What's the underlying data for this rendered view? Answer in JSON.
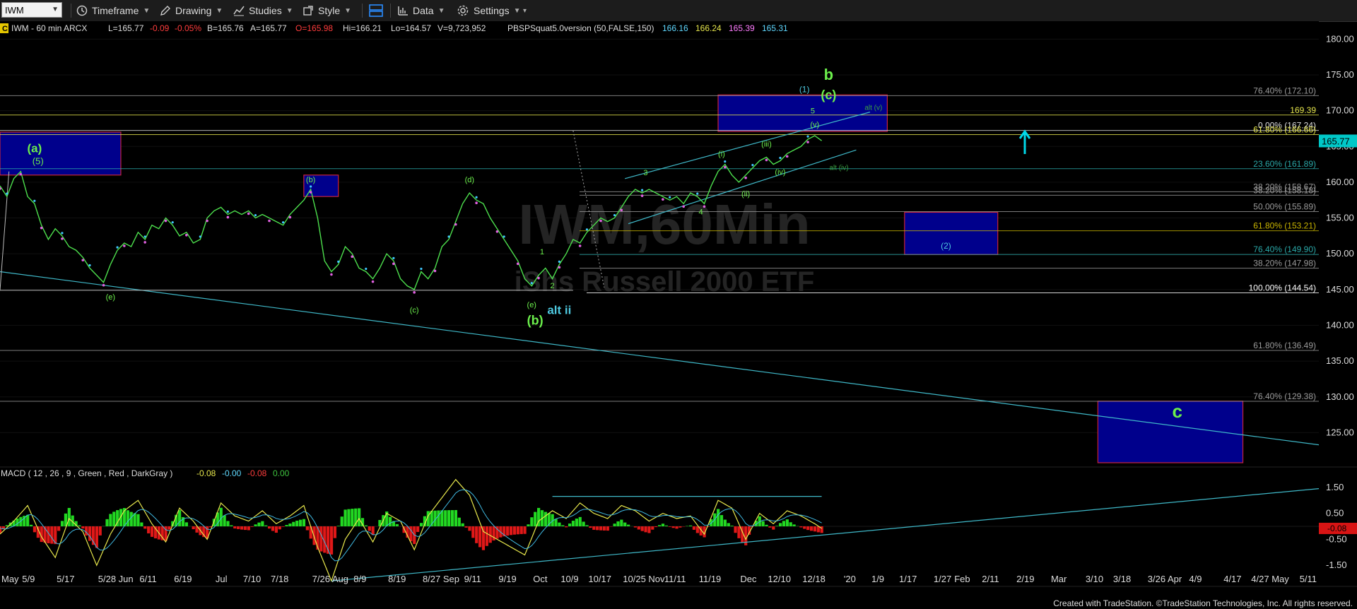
{
  "toolbar": {
    "symbol": "IWM",
    "timeframe": "Timeframe",
    "drawing": "Drawing",
    "studies": "Studies",
    "style": "Style",
    "data": "Data",
    "settings": "Settings"
  },
  "header": {
    "c_badge": "C",
    "title": "IWM - 60 min  ARCX",
    "last": "L=165.77",
    "change": "-0.09",
    "pct": "-0.05%",
    "bid": "B=165.76",
    "ask": "A=165.77",
    "open": "O=165.98",
    "high": "Hi=166.21",
    "low": "Lo=164.57",
    "volume": "V=9,723,952",
    "study": "PBSPSquat5.0version (50,FALSE,150)",
    "study_v1": "166.16",
    "study_v2": "166.24",
    "study_v3": "165.39",
    "study_v4": "165.31"
  },
  "watermark": {
    "symbol": "IWM,60Min",
    "name": "iShs Russell 2000 ETF"
  },
  "copyright": "Created with TradeStation. ©TradeStation Technologies, Inc. All rights reserved.",
  "chart_data": [
    {
      "type": "line",
      "title": "IWM - 60 min",
      "ylim": [
        120.5,
        182.5
      ],
      "y_ticks": [
        180,
        175,
        170,
        165,
        160,
        155,
        150,
        145,
        140,
        135,
        130,
        125
      ],
      "y_tick_labels": [
        "180.00",
        "175.00",
        "170.00",
        "165.00",
        "160.00",
        "155.00",
        "150.00",
        "145.00",
        "140.00",
        "135.00",
        "130.00",
        "125.00"
      ],
      "last_price": {
        "value": 165.77,
        "label": "165.77",
        "color": "#00c8c8"
      },
      "x_tick_labels": [
        {
          "label": "May",
          "x": 0
        },
        {
          "label": "5/9",
          "x": 3
        },
        {
          "label": "5/17",
          "x": 8
        },
        {
          "label": "5/28 Jun",
          "x": 14
        },
        {
          "label": "6/11",
          "x": 20
        },
        {
          "label": "6/19",
          "x": 25
        },
        {
          "label": "Jul",
          "x": 31
        },
        {
          "label": "7/10",
          "x": 35
        },
        {
          "label": "7/18",
          "x": 39
        },
        {
          "label": "7/26 Aug",
          "x": 45
        },
        {
          "label": "8/9",
          "x": 51
        },
        {
          "label": "8/19",
          "x": 56
        },
        {
          "label": "8/27 Sep",
          "x": 61
        },
        {
          "label": "9/11",
          "x": 67
        },
        {
          "label": "9/19",
          "x": 72
        },
        {
          "label": "Oct",
          "x": 77
        },
        {
          "label": "10/9",
          "x": 81
        },
        {
          "label": "10/17",
          "x": 85
        },
        {
          "label": "10/25 Nov",
          "x": 90
        },
        {
          "label": "11/11",
          "x": 96
        },
        {
          "label": "11/19",
          "x": 101
        },
        {
          "label": "Dec",
          "x": 107
        },
        {
          "label": "12/10",
          "x": 111
        },
        {
          "label": "12/18",
          "x": 116
        },
        {
          "label": "'20",
          "x": 122
        },
        {
          "label": "1/9",
          "x": 126
        },
        {
          "label": "1/17",
          "x": 130
        },
        {
          "label": "1/27",
          "x": 135
        },
        {
          "label": "Feb",
          "x": 138
        },
        {
          "label": "2/11",
          "x": 142
        },
        {
          "label": "2/19",
          "x": 147
        },
        {
          "label": "Mar",
          "x": 152
        },
        {
          "label": "3/10",
          "x": 157
        },
        {
          "label": "3/18",
          "x": 161
        },
        {
          "label": "3/26 Apr",
          "x": 166
        },
        {
          "label": "4/9",
          "x": 172
        },
        {
          "label": "4/17",
          "x": 177
        },
        {
          "label": "4/27 May",
          "x": 181
        },
        {
          "label": "5/11",
          "x": 188
        }
      ],
      "x_range": [
        0,
        191
      ],
      "price": [
        [
          0,
          159.5
        ],
        [
          1,
          158.0
        ],
        [
          2,
          160.5
        ],
        [
          3,
          161.5
        ],
        [
          4,
          158.0
        ],
        [
          5,
          157.0
        ],
        [
          6,
          154.0
        ],
        [
          7,
          152.0
        ],
        [
          8,
          153.5
        ],
        [
          9,
          152.5
        ],
        [
          10,
          151.0
        ],
        [
          11,
          150.5
        ],
        [
          12,
          149.5
        ],
        [
          13,
          148.0
        ],
        [
          14,
          147.0
        ],
        [
          15,
          146.0
        ],
        [
          16,
          148.5
        ],
        [
          17,
          150.5
        ],
        [
          18,
          151.5
        ],
        [
          19,
          151.0
        ],
        [
          20,
          153.0
        ],
        [
          21,
          152.0
        ],
        [
          22,
          154.0
        ],
        [
          23,
          153.5
        ],
        [
          24,
          155.0
        ],
        [
          25,
          154.0
        ],
        [
          26,
          152.5
        ],
        [
          27,
          153.0
        ],
        [
          28,
          151.5
        ],
        [
          29,
          152.0
        ],
        [
          30,
          155.0
        ],
        [
          31,
          156.0
        ],
        [
          32,
          156.5
        ],
        [
          33,
          155.5
        ],
        [
          34,
          156.0
        ],
        [
          35,
          155.5
        ],
        [
          36,
          156.0
        ],
        [
          37,
          155.0
        ],
        [
          38,
          155.5
        ],
        [
          39,
          155.0
        ],
        [
          40,
          154.5
        ],
        [
          41,
          154.0
        ],
        [
          42,
          155.5
        ],
        [
          43,
          156.5
        ],
        [
          44,
          157.5
        ],
        [
          45,
          159.0
        ],
        [
          46,
          155.0
        ],
        [
          47,
          149.0
        ],
        [
          48,
          147.5
        ],
        [
          49,
          148.5
        ],
        [
          50,
          151.0
        ],
        [
          51,
          150.0
        ],
        [
          52,
          148.0
        ],
        [
          53,
          147.5
        ],
        [
          54,
          146.5
        ],
        [
          55,
          148.0
        ],
        [
          56,
          150.0
        ],
        [
          57,
          149.0
        ],
        [
          58,
          146.5
        ],
        [
          59,
          145.5
        ],
        [
          60,
          145.0
        ],
        [
          61,
          147.5
        ],
        [
          62,
          146.5
        ],
        [
          63,
          148.0
        ],
        [
          64,
          151.0
        ],
        [
          65,
          152.0
        ],
        [
          66,
          154.5
        ],
        [
          67,
          157.0
        ],
        [
          68,
          158.5
        ],
        [
          69,
          157.5
        ],
        [
          70,
          157.0
        ],
        [
          71,
          155.0
        ],
        [
          72,
          153.5
        ],
        [
          73,
          152.0
        ],
        [
          74,
          150.5
        ],
        [
          75,
          149.0
        ],
        [
          76,
          146.5
        ],
        [
          77,
          145.5
        ],
        [
          78,
          147.0
        ],
        [
          79,
          148.0
        ],
        [
          80,
          146.5
        ],
        [
          81,
          148.5
        ],
        [
          82,
          150.0
        ],
        [
          83,
          152.0
        ],
        [
          84,
          151.5
        ],
        [
          85,
          153.0
        ],
        [
          86,
          154.0
        ],
        [
          87,
          155.0
        ],
        [
          88,
          154.5
        ],
        [
          89,
          155.0
        ],
        [
          90,
          156.5
        ],
        [
          91,
          158.0
        ],
        [
          92,
          159.0
        ],
        [
          93,
          158.5
        ],
        [
          94,
          159.0
        ],
        [
          95,
          158.5
        ],
        [
          96,
          158.0
        ],
        [
          97,
          157.5
        ],
        [
          98,
          158.0
        ],
        [
          99,
          157.0
        ],
        [
          100,
          158.5
        ],
        [
          101,
          158.0
        ],
        [
          102,
          157.0
        ],
        [
          103,
          159.5
        ],
        [
          104,
          161.5
        ],
        [
          105,
          162.5
        ],
        [
          106,
          161.0
        ],
        [
          107,
          160.0
        ],
        [
          108,
          161.0
        ],
        [
          109,
          162.0
        ],
        [
          110,
          163.0
        ],
        [
          111,
          163.5
        ],
        [
          112,
          162.5
        ],
        [
          113,
          163.0
        ],
        [
          114,
          164.0
        ],
        [
          115,
          164.5
        ],
        [
          116,
          165.0
        ],
        [
          117,
          166.0
        ],
        [
          118,
          166.5
        ],
        [
          119,
          165.8
        ]
      ],
      "fib_levels": [
        {
          "label": "76.40% (172.10)",
          "value": 172.1
        },
        {
          "label": "169.39",
          "value": 169.39
        },
        {
          "label": "0.00% (167.24)",
          "value": 167.24
        },
        {
          "label": "61.80% (166.66)",
          "value": 166.66
        },
        {
          "label": "23.60% (161.89)",
          "value": 161.89
        },
        {
          "label": "38.20% (158.67)",
          "value": 158.67
        },
        {
          "label": "38.20% (158.18)",
          "value": 158.18
        },
        {
          "label": "50.00% (155.89)",
          "value": 155.89
        },
        {
          "label": "61.80% (153.21)",
          "value": 153.21
        },
        {
          "label": "76.40% (149.90)",
          "value": 149.9
        },
        {
          "label": "38.20% (147.98)",
          "value": 147.98
        },
        {
          "label": "100.00% (144.54)",
          "value": 144.54
        },
        {
          "label": "100.00% (144.54)",
          "value": 144.54
        },
        {
          "label": "61.80% (136.49)",
          "value": 136.49
        },
        {
          "label": "76.40% (129.38)",
          "value": 129.38
        }
      ],
      "wave_labels": [
        {
          "text": "(a)",
          "x": 5,
          "y": 164.2,
          "color": "#6cf04c",
          "size": 17
        },
        {
          "text": "(5)",
          "x": 5.5,
          "y": 162.5,
          "color": "#6cf04c",
          "size": 13
        },
        {
          "text": "(e)",
          "x": 16,
          "y": 143.6,
          "color": "#6cf04c",
          "size": 11
        },
        {
          "text": "(b)",
          "x": 45,
          "y": 160.0,
          "color": "#6cf04c",
          "size": 11
        },
        {
          "text": "(c)",
          "x": 60,
          "y": 141.8,
          "color": "#6cf04c",
          "size": 11
        },
        {
          "text": "(d)",
          "x": 68,
          "y": 160.0,
          "color": "#6cf04c",
          "size": 11
        },
        {
          "text": "1",
          "x": 78.5,
          "y": 149.9,
          "color": "#6cf04c",
          "size": 11
        },
        {
          "text": "(e)",
          "x": 77,
          "y": 142.5,
          "color": "#6cf04c",
          "size": 11
        },
        {
          "text": "2",
          "x": 80,
          "y": 145.2,
          "color": "#6cf04c",
          "size": 11
        },
        {
          "text": "(b)",
          "x": 77.5,
          "y": 140.1,
          "color": "#6cf04c",
          "size": 18
        },
        {
          "text": "alt ii",
          "x": 81,
          "y": 141.6,
          "color": "#4ec9e0",
          "size": 17
        },
        {
          "text": "3",
          "x": 93.5,
          "y": 161.0,
          "color": "#6cf04c",
          "size": 11
        },
        {
          "text": "4",
          "x": 101.5,
          "y": 155.5,
          "color": "#6cf04c",
          "size": 11
        },
        {
          "text": "(i)",
          "x": 104.5,
          "y": 163.6,
          "color": "#6cf04c",
          "size": 11
        },
        {
          "text": "(ii)",
          "x": 108,
          "y": 158.0,
          "color": "#6cf04c",
          "size": 11
        },
        {
          "text": "(iii)",
          "x": 111,
          "y": 165.0,
          "color": "#6cf04c",
          "size": 11
        },
        {
          "text": "(iv)",
          "x": 113,
          "y": 161.1,
          "color": "#6cf04c",
          "size": 11
        },
        {
          "text": "(v)",
          "x": 118,
          "y": 167.7,
          "color": "#6cf04c",
          "size": 11
        },
        {
          "text": "5",
          "x": 117.7,
          "y": 169.6,
          "color": "#6cf04c",
          "size": 11
        },
        {
          "text": "(1)",
          "x": 116.5,
          "y": 172.6,
          "color": "#4ec9e0",
          "size": 12
        },
        {
          "text": "b",
          "x": 120,
          "y": 174.3,
          "color": "#6cf04c",
          "size": 22
        },
        {
          "text": "(c)",
          "x": 120,
          "y": 171.6,
          "color": "#6cf04c",
          "size": 18
        },
        {
          "text": "alt (v)",
          "x": 126.5,
          "y": 170.1,
          "color": "#3aa040",
          "size": 10
        },
        {
          "text": "alt (iv)",
          "x": 121.5,
          "y": 161.7,
          "color": "#3aa040",
          "size": 10
        },
        {
          "text": "(2)",
          "x": 137,
          "y": 150.7,
          "color": "#4ec9e0",
          "size": 12
        },
        {
          "text": "c",
          "x": 170.5,
          "y": 127.1,
          "color": "#6cf04c",
          "size": 26
        }
      ],
      "target_boxes": [
        {
          "x1": 0,
          "x2": 17.5,
          "y1": 167.0,
          "y2": 161.0
        },
        {
          "x1": 44,
          "x2": 49,
          "y1": 161.0,
          "y2": 158.0
        },
        {
          "x1": 104,
          "x2": 128.5,
          "y1": 172.2,
          "y2": 167.1
        },
        {
          "x1": 131,
          "x2": 144.5,
          "y1": 155.8,
          "y2": 149.9
        },
        {
          "x1": 159,
          "x2": 180,
          "y1": 129.4,
          "y2": 120.8
        }
      ]
    },
    {
      "type": "line",
      "title": "MACD ( 12 , 26 , 9 , Green , Red , DarkGray )",
      "values_text": [
        "-0.08",
        "-0.00",
        "-0.08",
        "0.00"
      ],
      "ylim": [
        -2.2,
        2.2
      ],
      "y_ticks": [
        1.5,
        0.5,
        -0.5,
        -1.5
      ],
      "y_tick_labels": [
        "1.50",
        "0.50",
        "-0.50",
        "-1.50"
      ],
      "last_value": {
        "value": -0.08,
        "label": "-0.08",
        "color": "#d81414"
      },
      "macd": [
        [
          0,
          -0.3
        ],
        [
          2,
          0.2
        ],
        [
          4,
          0.8
        ],
        [
          6,
          -0.4
        ],
        [
          8,
          -1.2
        ],
        [
          10,
          0.3
        ],
        [
          12,
          -0.2
        ],
        [
          14,
          -1.5
        ],
        [
          16,
          -0.3
        ],
        [
          18,
          0.6
        ],
        [
          20,
          1.0
        ],
        [
          22,
          0.1
        ],
        [
          24,
          -0.6
        ],
        [
          26,
          0.7
        ],
        [
          28,
          0.2
        ],
        [
          30,
          -0.5
        ],
        [
          32,
          0.9
        ],
        [
          34,
          0.4
        ],
        [
          36,
          0.2
        ],
        [
          38,
          0.6
        ],
        [
          40,
          0.1
        ],
        [
          42,
          0.4
        ],
        [
          44,
          0.8
        ],
        [
          46,
          -0.8
        ],
        [
          48,
          -2.1
        ],
        [
          50,
          -0.5
        ],
        [
          52,
          0.3
        ],
        [
          54,
          -0.6
        ],
        [
          56,
          0.5
        ],
        [
          58,
          0.2
        ],
        [
          60,
          -0.9
        ],
        [
          62,
          0.4
        ],
        [
          64,
          1.1
        ],
        [
          66,
          1.8
        ],
        [
          68,
          1.2
        ],
        [
          70,
          -0.2
        ],
        [
          72,
          -0.5
        ],
        [
          74,
          -0.8
        ],
        [
          76,
          -1.1
        ],
        [
          78,
          0.2
        ],
        [
          80,
          0.6
        ],
        [
          82,
          0.3
        ],
        [
          84,
          0.9
        ],
        [
          86,
          0.5
        ],
        [
          88,
          0.3
        ],
        [
          90,
          0.8
        ],
        [
          92,
          0.6
        ],
        [
          94,
          0.2
        ],
        [
          96,
          0.5
        ],
        [
          98,
          0.3
        ],
        [
          100,
          0.4
        ],
        [
          102,
          -0.3
        ],
        [
          104,
          1.0
        ],
        [
          106,
          0.7
        ],
        [
          108,
          -0.5
        ],
        [
          110,
          0.5
        ],
        [
          112,
          0.1
        ],
        [
          114,
          0.6
        ],
        [
          116,
          0.4
        ],
        [
          118,
          0.1
        ],
        [
          119,
          -0.08
        ]
      ]
    }
  ]
}
